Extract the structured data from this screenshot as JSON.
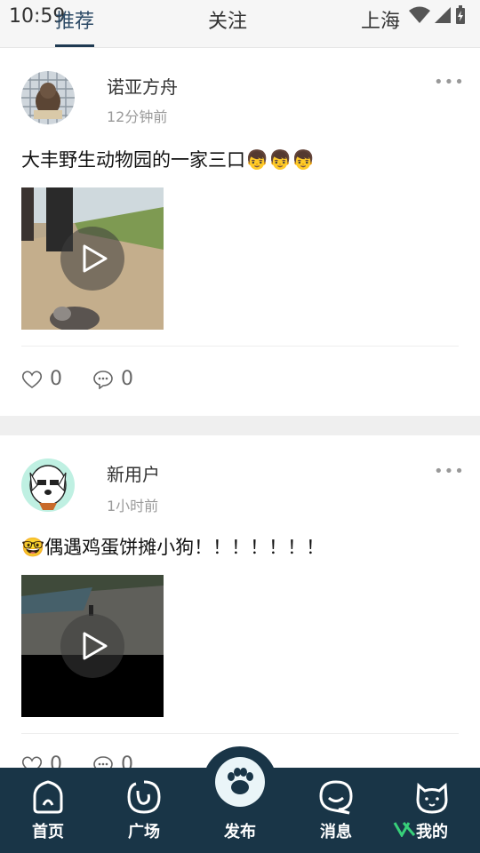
{
  "status_bar": {
    "time": "10:59"
  },
  "header": {
    "tabs": [
      {
        "label": "推荐",
        "active": true
      },
      {
        "label": "关注",
        "active": false
      }
    ],
    "city": "上海"
  },
  "posts": [
    {
      "username": "诺亚方舟",
      "time": "12分钟前",
      "content": "大丰野生动物园的一家三口👦👦👦",
      "media": "video",
      "likes": "0",
      "comments": "0"
    },
    {
      "username": "新用户",
      "time": "1小时前",
      "content": "🤓偶遇鸡蛋饼摊小狗！！！！！！！",
      "media": "video",
      "likes": "0",
      "comments": "0"
    }
  ],
  "bottom_nav": {
    "items": [
      {
        "label": "首页",
        "icon": "home-icon"
      },
      {
        "label": "广场",
        "icon": "square-icon"
      },
      {
        "label": "发布",
        "icon": "paw-icon"
      },
      {
        "label": "消息",
        "icon": "message-icon"
      },
      {
        "label": "我的",
        "icon": "cat-face-icon"
      }
    ]
  },
  "colors": {
    "nav_bg": "#193547",
    "accent": "#1f3a52"
  }
}
